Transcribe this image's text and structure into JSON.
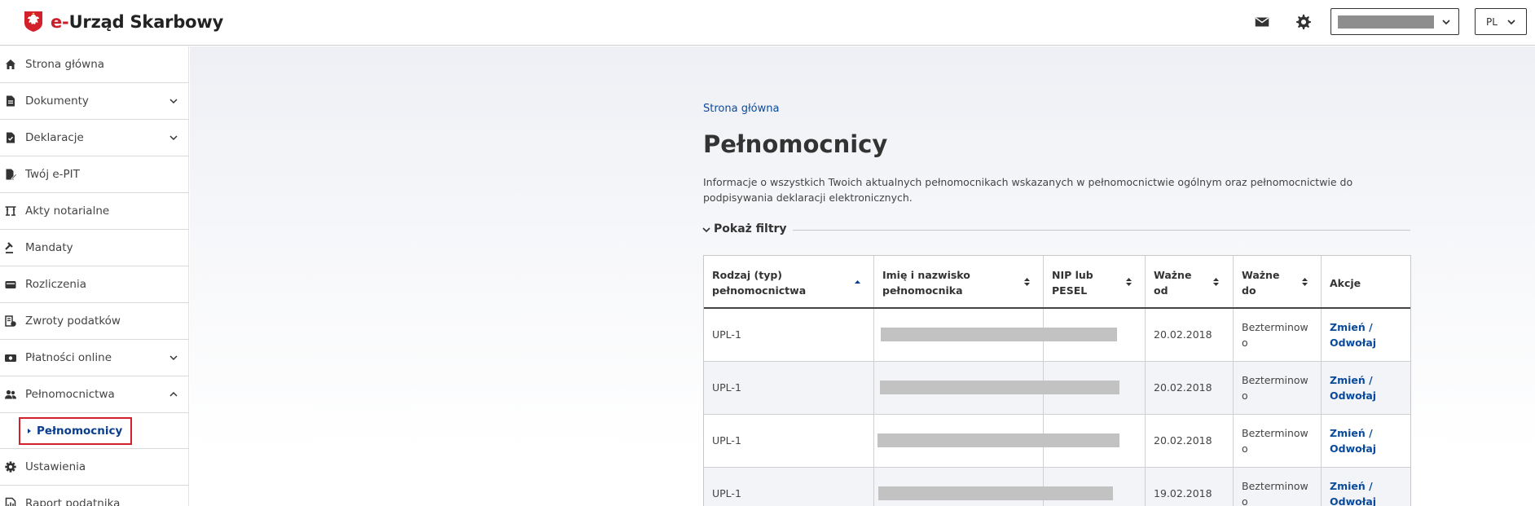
{
  "header": {
    "app_title_prefix": "e-",
    "app_title": "Urząd Skarbowy",
    "user_select_value": "",
    "language": "PL",
    "icons": [
      "mail-icon",
      "gear-icon",
      "chevron-down-icon"
    ]
  },
  "sidebar": {
    "items": [
      {
        "label": "Strona główna",
        "icon": "home-icon"
      },
      {
        "label": "Dokumenty",
        "icon": "document-icon",
        "expandable": true
      },
      {
        "label": "Deklaracje",
        "icon": "declaration-icon",
        "expandable": true
      },
      {
        "label": "Twój e-PIT",
        "icon": "pen-document-icon"
      },
      {
        "label": "Akty notarialne",
        "icon": "notary-icon"
      },
      {
        "label": "Mandaty",
        "icon": "gavel-icon"
      },
      {
        "label": "Rozliczenia",
        "icon": "wallet-icon"
      },
      {
        "label": "Zwroty podatków",
        "icon": "refund-icon"
      },
      {
        "label": "Płatności online",
        "icon": "payment-icon",
        "expandable": true
      },
      {
        "label": "Pełnomocnictwa",
        "icon": "users-icon",
        "expanded": true
      },
      {
        "label": "Ustawienia",
        "icon": "gear-icon"
      },
      {
        "label": "Raport podatnika",
        "icon": "report-icon"
      }
    ],
    "active_subitem": "Pełnomocnicy",
    "highlight_color": "#d3212b"
  },
  "main": {
    "breadcrumb": "Strona główna",
    "title": "Pełnomocnicy",
    "intro": "Informacje o wszystkich Twoich aktualnych pełnomocnikach wskazanych w pełnomocnictwie ogólnym oraz pełnomocnictwie do podpisywania deklaracji elektronicznych.",
    "filters_label": "Pokaż filtry",
    "table": {
      "headers": [
        {
          "line1": "Rodzaj (typ)",
          "line2": "pełnomocnictwa",
          "sort": "asc"
        },
        {
          "line1": "Imię i nazwisko",
          "line2": "pełnomocnika",
          "sort": "none"
        },
        {
          "line1": "NIP lub",
          "line2": "PESEL",
          "sort": "none"
        },
        {
          "line1": "Ważne",
          "line2": "od",
          "sort": "none"
        },
        {
          "line1": "Ważne",
          "line2": "do",
          "sort": "none"
        },
        {
          "line1": "Akcje",
          "line2": ""
        }
      ],
      "rows": [
        {
          "type": "UPL-1",
          "name": "",
          "nip": "",
          "from": "20.02.2018",
          "to_line1": "Bezterminow",
          "to_line2": "o",
          "action_line1": "Zmień /",
          "action_line2": "Odwołaj"
        },
        {
          "type": "UPL-1",
          "name": "",
          "nip": "",
          "from": "20.02.2018",
          "to_line1": "Bezterminow",
          "to_line2": "o",
          "action_line1": "Zmień /",
          "action_line2": "Odwołaj"
        },
        {
          "type": "UPL-1",
          "name": "",
          "nip": "",
          "from": "20.02.2018",
          "to_line1": "Bezterminow",
          "to_line2": "o",
          "action_line1": "Zmień /",
          "action_line2": "Odwołaj"
        },
        {
          "type": "UPL-1",
          "name": "",
          "nip": "",
          "from": "19.02.2018",
          "to_line1": "Bezterminow",
          "to_line2": "o",
          "action_line1": "Zmień /",
          "action_line2": "Odwołaj"
        }
      ]
    },
    "colors": {
      "link": "#0a4a9c",
      "brand_red": "#c9202c",
      "redaction": "#c2c2c2"
    }
  }
}
